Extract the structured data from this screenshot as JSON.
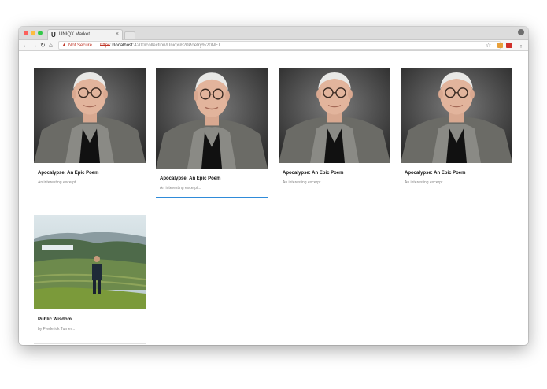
{
  "browser": {
    "tab_title": "UNIQX Market",
    "tab_favicon": "U",
    "not_secure_label": "Not Secure",
    "url_scheme": "https",
    "url_sep": "://",
    "url_host": "localhost",
    "url_rest": ":4200/collection/Uniqx%20Poetry%20NFT",
    "icons": [
      "back-icon",
      "forward-icon",
      "reload-icon",
      "home-icon",
      "warning-icon",
      "star-icon",
      "menu-icon",
      "profile-icon",
      "close-icon"
    ]
  },
  "cards": [
    {
      "title": "Apocalypse: An Epic Poem",
      "excerpt": "An interesting excerpt...",
      "image": "portrait",
      "state": "normal"
    },
    {
      "title": "Apocalypse: An Epic Poem",
      "excerpt": "An interesting excerpt...",
      "image": "portrait",
      "state": "hover"
    },
    {
      "title": "Apocalypse: An Epic Poem",
      "excerpt": "An interesting excerpt...",
      "image": "portrait",
      "state": "normal"
    },
    {
      "title": "Apocalypse: An Epic Poem",
      "excerpt": "An interesting excerpt...",
      "image": "portrait",
      "state": "normal"
    },
    {
      "title": "Public Wisdom",
      "excerpt": "by Frederick Turner...",
      "image": "landscape",
      "state": "normal"
    }
  ],
  "colors": {
    "accent": "#2f8bd9",
    "warning": "#c0392b"
  }
}
